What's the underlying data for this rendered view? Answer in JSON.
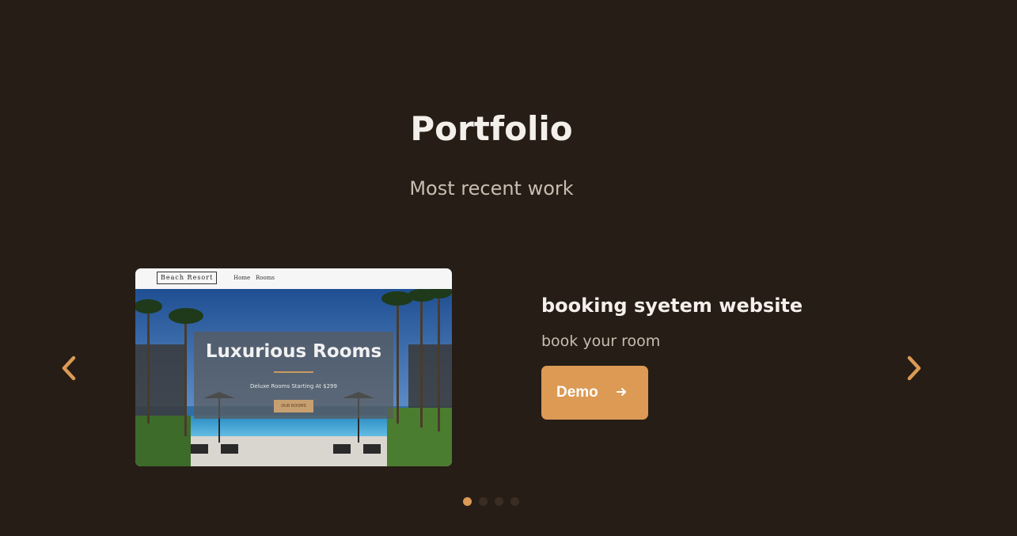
{
  "section": {
    "title": "Portfolio",
    "subtitle": "Most recent work"
  },
  "project": {
    "title": "booking syetem website",
    "description": "book your room",
    "demo_label": "Demo",
    "demo_icon": "arrow-right-icon"
  },
  "preview": {
    "logo": "Beach Resort",
    "nav_links": [
      "Home",
      "Rooms"
    ],
    "hero_title": "Luxurious Rooms",
    "hero_subtitle": "Deluxe Rooms Starting At $299",
    "hero_button": "OUR ROOMS"
  },
  "navigation": {
    "prev_icon": "chevron-left-icon",
    "next_icon": "chevron-right-icon"
  },
  "pagination": {
    "total": 4,
    "active_index": 0
  },
  "colors": {
    "background": "#261d16",
    "accent": "#dc9a55",
    "title_text": "#f3efea",
    "muted_text": "#c9bdb1",
    "dot_inactive": "#3b2d22"
  }
}
